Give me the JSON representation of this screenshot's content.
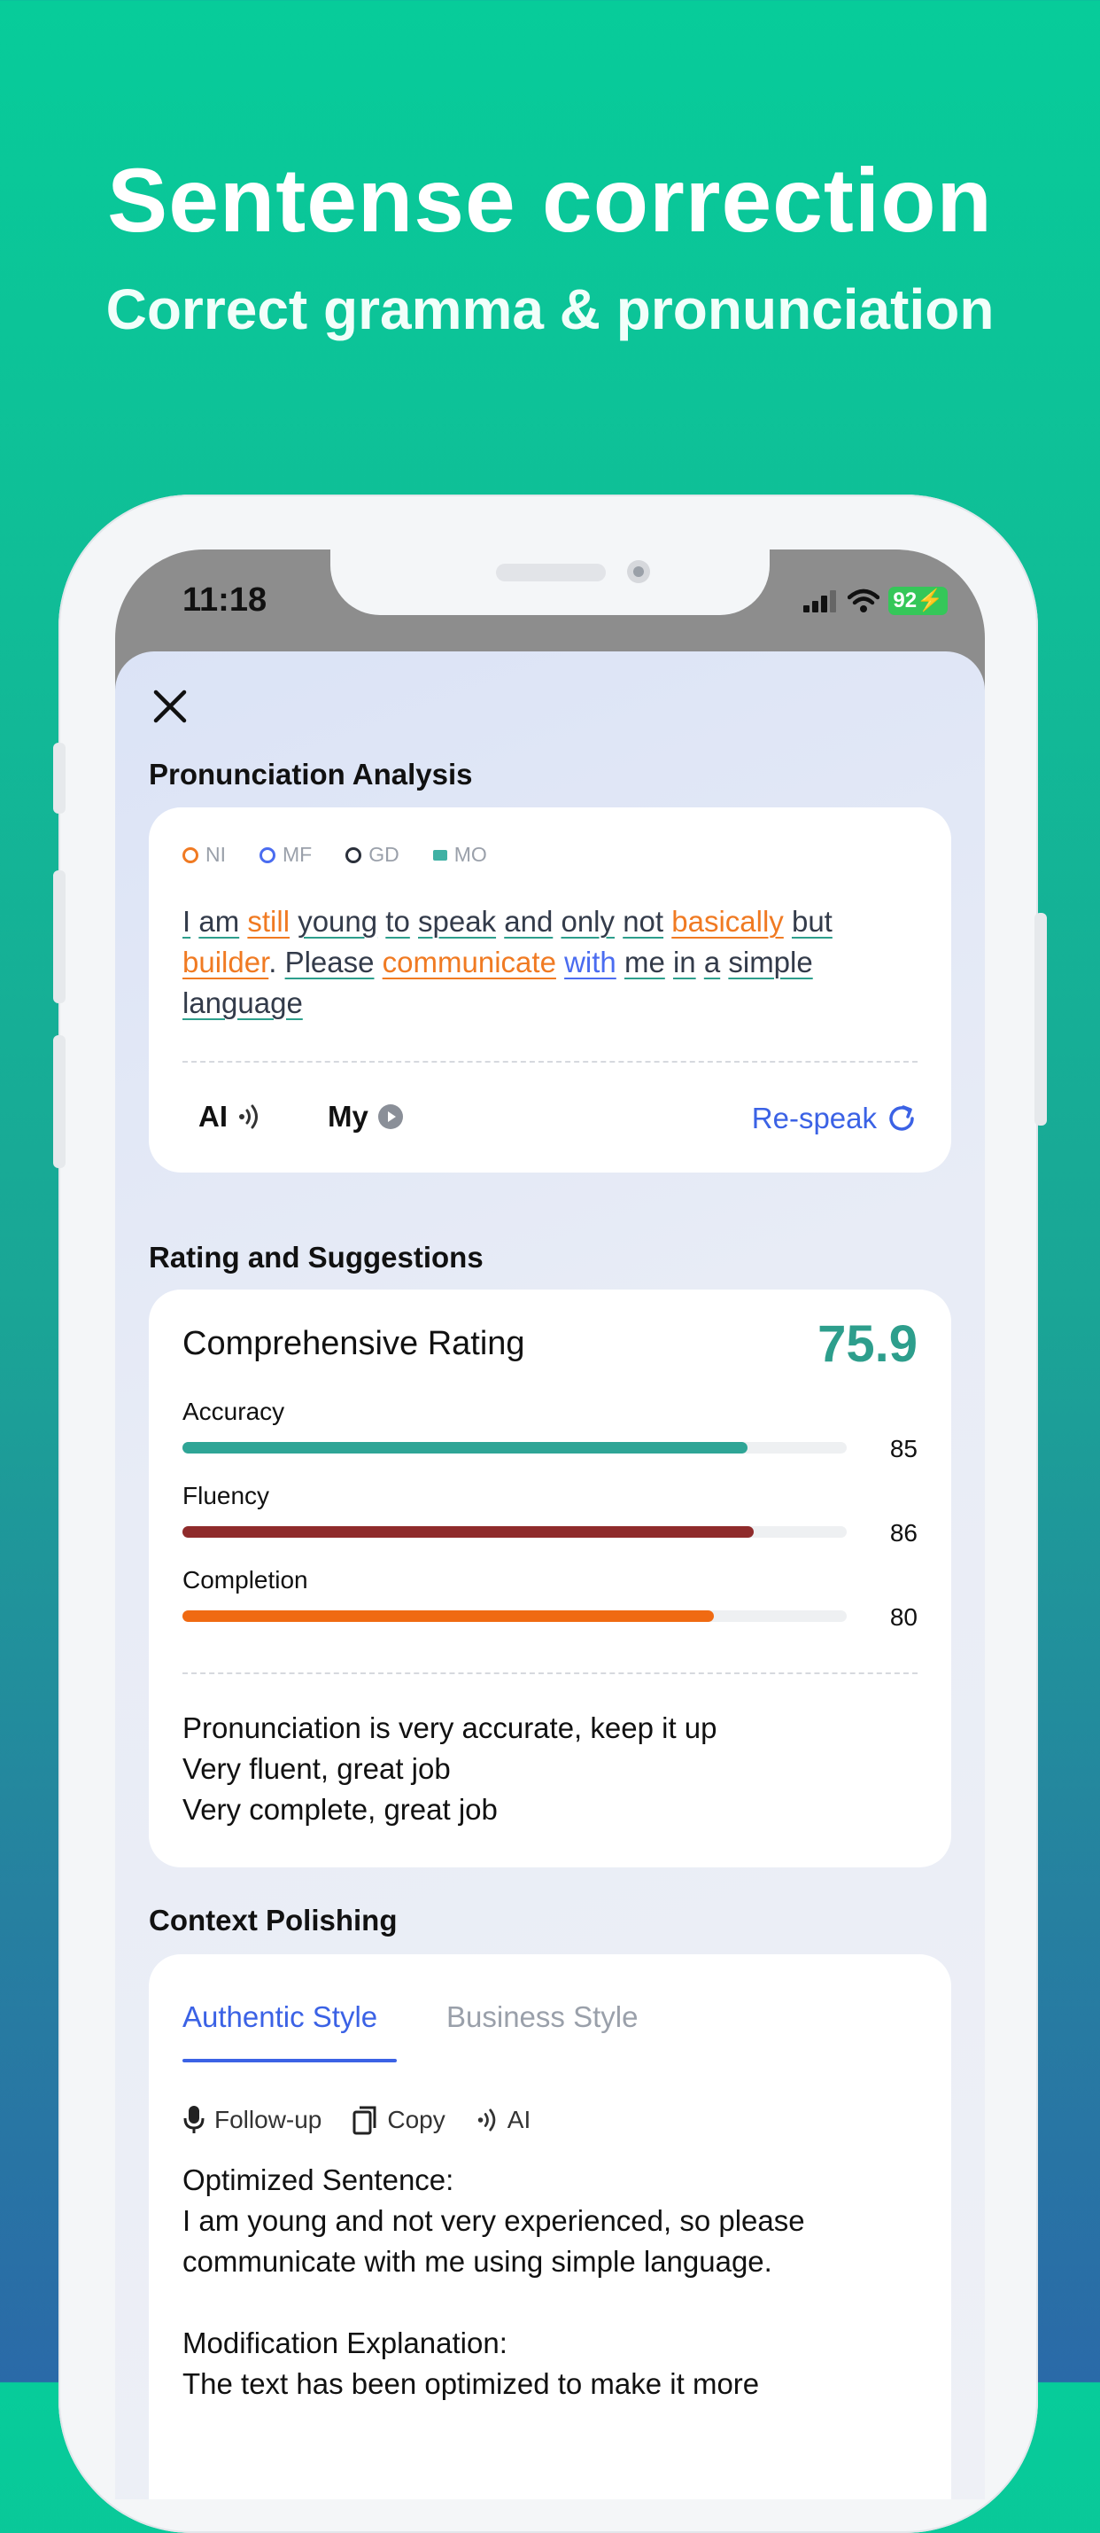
{
  "hero": {
    "title": "Sentense correction",
    "subtitle": "Correct gramma & pronunciation"
  },
  "status_bar": {
    "time": "11:18",
    "battery": "92"
  },
  "colors": {
    "accent_blue": "#3b62e5",
    "teal": "#2d9e8c",
    "orange": "#f07a22",
    "dark_red": "#8f2b2b"
  },
  "pronunciation": {
    "section_title": "Pronunciation Analysis",
    "legend": [
      {
        "label": "NI",
        "color": "#f07a22"
      },
      {
        "label": "MF",
        "color": "#4a6cf0"
      },
      {
        "label": "GD",
        "color": "#2a2f3a"
      },
      {
        "label": "MO",
        "color": "#3fb1a4"
      }
    ],
    "words": [
      {
        "t": "I",
        "c": "#333b4a",
        "u": "#2d9e8c"
      },
      {
        "t": "am",
        "c": "#333b4a",
        "u": "#2d9e8c"
      },
      {
        "t": "still",
        "c": "#f07a22",
        "u": "#f07a22"
      },
      {
        "t": "young",
        "c": "#333b4a",
        "u": "#2d9e8c"
      },
      {
        "t": "to",
        "c": "#333b4a",
        "u": "#2d9e8c"
      },
      {
        "t": "speak",
        "c": "#333b4a",
        "u": "#2d9e8c"
      },
      {
        "t": "and",
        "c": "#333b4a",
        "u": "#2d9e8c"
      },
      {
        "t": "only",
        "c": "#333b4a",
        "u": "#2d9e8c"
      },
      {
        "t": "not",
        "c": "#333b4a",
        "u": "#2d9e8c"
      },
      {
        "t": "basically",
        "c": "#f07a22",
        "u": "#f07a22"
      },
      {
        "t": "but",
        "c": "#333b4a",
        "u": "#2d9e8c"
      },
      {
        "t": "builder",
        "c": "#f07a22",
        "u": "#f07a22",
        "punct": "."
      },
      {
        "t": "Please",
        "c": "#333b4a",
        "u": "#2d9e8c"
      },
      {
        "t": "communicate",
        "c": "#f07a22",
        "u": "#f07a22"
      },
      {
        "t": "with",
        "c": "#4a6cf0",
        "u": "#4a6cf0"
      },
      {
        "t": "me",
        "c": "#333b4a",
        "u": "#2d9e8c"
      },
      {
        "t": "in",
        "c": "#333b4a",
        "u": "#2d9e8c"
      },
      {
        "t": "a",
        "c": "#333b4a",
        "u": "#2d9e8c"
      },
      {
        "t": "simple",
        "c": "#333b4a",
        "u": "#2d9e8c"
      },
      {
        "t": "language",
        "c": "#333b4a",
        "u": "#2d9e8c"
      }
    ],
    "ai_label": "AI",
    "my_label": "My",
    "respeak_label": "Re-speak"
  },
  "rating": {
    "section_title": "Rating and Suggestions",
    "head": "Comprehensive Rating",
    "score": "75.9",
    "metrics": [
      {
        "label": "Accuracy",
        "value": 85,
        "fill_fraction": 0.85,
        "color": "#2fa596"
      },
      {
        "label": "Fluency",
        "value": 86,
        "fill_fraction": 0.86,
        "color": "#8f2b2b"
      },
      {
        "label": "Completion",
        "value": 80,
        "fill_fraction": 0.8,
        "color": "#f06a12"
      }
    ],
    "suggestions": [
      "Pronunciation is very accurate, keep it up",
      "Very fluent, great job",
      "Very complete, great job"
    ]
  },
  "polishing": {
    "section_title": "Context Polishing",
    "tabs": [
      "Authentic Style",
      "Business Style"
    ],
    "actions": {
      "follow_up": "Follow-up",
      "copy": "Copy",
      "ai": "AI"
    },
    "optimized_label": "Optimized Sentence:",
    "optimized_text": "I am young and not very experienced, so please communicate with me using simple language.",
    "explanation_label": "Modification Explanation:",
    "explanation_text": "The text has been optimized to make it more"
  }
}
